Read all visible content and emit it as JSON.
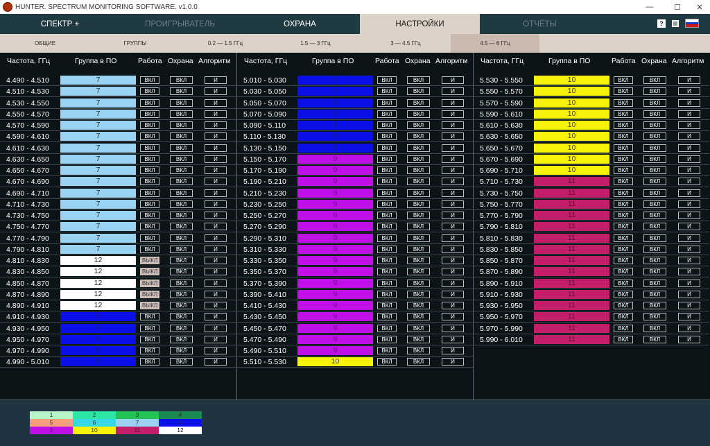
{
  "window": {
    "title": "HUNTER. SPECTRUM MONITORING SOFTWARE. v1.0.0",
    "minimize": "—",
    "maximize": "☐",
    "close": "✕"
  },
  "tabs": [
    {
      "label": "СПЕКТР +",
      "state": "normal"
    },
    {
      "label": "ПРОИГРЫВАТЕЛЬ",
      "state": "disabled"
    },
    {
      "label": "ОХРАНА",
      "state": "normal"
    },
    {
      "label": "НАСТРОЙКИ",
      "state": "active"
    },
    {
      "label": "ОТЧЁТЫ",
      "state": "disabled"
    }
  ],
  "tab_icons": {
    "help": "?",
    "doc": "document-icon"
  },
  "subtabs": [
    {
      "label": "ОБЩИЕ"
    },
    {
      "label": "ГРУППЫ"
    },
    {
      "label": "0.2 — 1.5 ГГц"
    },
    {
      "label": "1.5 — 3 ГГц"
    },
    {
      "label": "3 — 4.5 ГГц"
    },
    {
      "label": "4.5 — 6 ГГц",
      "active": true
    }
  ],
  "headers": {
    "freq": "Частота, ГГц",
    "group": "Группа в ПО",
    "work": "Работа",
    "guard": "Охрана",
    "algo": "Алгоритм"
  },
  "labels": {
    "on": "ВКЛ",
    "off": "ВЫКЛ",
    "algo": "И"
  },
  "group_colors": {
    "1": {
      "bg": "#b6f5c8",
      "fg": "#2a2a2a"
    },
    "2": {
      "bg": "#2ee6a4",
      "fg": "#2a2a2a"
    },
    "3": {
      "bg": "#22c454",
      "fg": "#2a2a2a"
    },
    "4": {
      "bg": "#1b8a52",
      "fg": "#2a2a2a"
    },
    "5": {
      "bg": "#f5a07a",
      "fg": "#3a3a3a"
    },
    "6": {
      "bg": "#36d8e6",
      "fg": "#2a2a2a"
    },
    "7": {
      "bg": "#9ad2f2",
      "fg": "#2a2a2a"
    },
    "8": {
      "bg": "#0c10e8",
      "fg": "#1a1a6a"
    },
    "9": {
      "bg": "#c010e8",
      "fg": "#5a1a70"
    },
    "10": {
      "bg": "#f6f20a",
      "fg": "#3a3a3a"
    },
    "11": {
      "bg": "#c21e6a",
      "fg": "#5a1030"
    },
    "12": {
      "bg": "#ffffff",
      "fg": "#1a1a1a"
    }
  },
  "columns": [
    [
      {
        "freq": "4.490 - 4.510",
        "group": "7",
        "work": "ВКЛ"
      },
      {
        "freq": "4.510 - 4.530",
        "group": "7",
        "work": "ВКЛ"
      },
      {
        "freq": "4.530 - 4.550",
        "group": "7",
        "work": "ВКЛ"
      },
      {
        "freq": "4.550 - 4.570",
        "group": "7",
        "work": "ВКЛ"
      },
      {
        "freq": "4.570 - 4.590",
        "group": "7",
        "work": "ВКЛ"
      },
      {
        "freq": "4.590 - 4.610",
        "group": "7",
        "work": "ВКЛ"
      },
      {
        "freq": "4.610 - 4.630",
        "group": "7",
        "work": "ВКЛ"
      },
      {
        "freq": "4.630 - 4.650",
        "group": "7",
        "work": "ВКЛ"
      },
      {
        "freq": "4.650 - 4.670",
        "group": "7",
        "work": "ВКЛ"
      },
      {
        "freq": "4.670 - 4.690",
        "group": "7",
        "work": "ВКЛ"
      },
      {
        "freq": "4.690 - 4.710",
        "group": "7",
        "work": "ВКЛ"
      },
      {
        "freq": "4.710 - 4.730",
        "group": "7",
        "work": "ВКЛ"
      },
      {
        "freq": "4.730 - 4.750",
        "group": "7",
        "work": "ВКЛ"
      },
      {
        "freq": "4.750 - 4.770",
        "group": "7",
        "work": "ВКЛ"
      },
      {
        "freq": "4.770 - 4.790",
        "group": "7",
        "work": "ВКЛ"
      },
      {
        "freq": "4.790 - 4.810",
        "group": "7",
        "work": "ВКЛ"
      },
      {
        "freq": "4.810 - 4.830",
        "group": "12",
        "work": "ВЫКЛ"
      },
      {
        "freq": "4.830 - 4.850",
        "group": "12",
        "work": "ВЫКЛ"
      },
      {
        "freq": "4.850 - 4.870",
        "group": "12",
        "work": "ВЫКЛ"
      },
      {
        "freq": "4.870 - 4.890",
        "group": "12",
        "work": "ВЫКЛ"
      },
      {
        "freq": "4.890 - 4.910",
        "group": "12",
        "work": "ВЫКЛ"
      },
      {
        "freq": "4.910 - 4.930",
        "group": "8",
        "work": "ВКЛ"
      },
      {
        "freq": "4.930 - 4.950",
        "group": "8",
        "work": "ВКЛ"
      },
      {
        "freq": "4.950 - 4.970",
        "group": "8",
        "work": "ВКЛ"
      },
      {
        "freq": "4.970 - 4.990",
        "group": "8",
        "work": "ВКЛ"
      },
      {
        "freq": "4.990 - 5.010",
        "group": "8",
        "work": "ВКЛ"
      }
    ],
    [
      {
        "freq": "5.010 - 5.030",
        "group": "8",
        "work": "ВКЛ"
      },
      {
        "freq": "5.030 - 5.050",
        "group": "8",
        "work": "ВКЛ"
      },
      {
        "freq": "5.050 - 5.070",
        "group": "8",
        "work": "ВКЛ"
      },
      {
        "freq": "5.070 - 5.090",
        "group": "8",
        "work": "ВКЛ"
      },
      {
        "freq": "5.090 - 5.110",
        "group": "8",
        "work": "ВКЛ"
      },
      {
        "freq": "5.110 - 5.130",
        "group": "8",
        "work": "ВКЛ"
      },
      {
        "freq": "5.130 - 5.150",
        "group": "8",
        "work": "ВКЛ"
      },
      {
        "freq": "5.150 - 5.170",
        "group": "9",
        "work": "ВКЛ"
      },
      {
        "freq": "5.170 - 5.190",
        "group": "9",
        "work": "ВКЛ"
      },
      {
        "freq": "5.190 - 5.210",
        "group": "9",
        "work": "ВКЛ"
      },
      {
        "freq": "5.210 - 5.230",
        "group": "9",
        "work": "ВКЛ"
      },
      {
        "freq": "5.230 - 5.250",
        "group": "9",
        "work": "ВКЛ"
      },
      {
        "freq": "5.250 - 5.270",
        "group": "9",
        "work": "ВКЛ"
      },
      {
        "freq": "5.270 - 5.290",
        "group": "9",
        "work": "ВКЛ"
      },
      {
        "freq": "5.290 - 5.310",
        "group": "9",
        "work": "ВКЛ"
      },
      {
        "freq": "5.310 - 5.330",
        "group": "9",
        "work": "ВКЛ"
      },
      {
        "freq": "5.330 - 5.350",
        "group": "9",
        "work": "ВКЛ"
      },
      {
        "freq": "5.350 - 5.370",
        "group": "9",
        "work": "ВКЛ"
      },
      {
        "freq": "5.370 - 5.390",
        "group": "9",
        "work": "ВКЛ"
      },
      {
        "freq": "5.390 - 5.410",
        "group": "9",
        "work": "ВКЛ"
      },
      {
        "freq": "5.410 - 5.430",
        "group": "9",
        "work": "ВКЛ"
      },
      {
        "freq": "5.430 - 5.450",
        "group": "9",
        "work": "ВКЛ"
      },
      {
        "freq": "5.450 - 5.470",
        "group": "9",
        "work": "ВКЛ"
      },
      {
        "freq": "5.470 - 5.490",
        "group": "9",
        "work": "ВКЛ"
      },
      {
        "freq": "5.490 - 5.510",
        "group": "9",
        "work": "ВКЛ"
      },
      {
        "freq": "5.510 - 5.530",
        "group": "10",
        "work": "ВКЛ"
      }
    ],
    [
      {
        "freq": "5.530 - 5.550",
        "group": "10",
        "work": "ВКЛ"
      },
      {
        "freq": "5.550 - 5.570",
        "group": "10",
        "work": "ВКЛ"
      },
      {
        "freq": "5.570 - 5.590",
        "group": "10",
        "work": "ВКЛ"
      },
      {
        "freq": "5.590 - 5.610",
        "group": "10",
        "work": "ВКЛ"
      },
      {
        "freq": "5.610 - 5.630",
        "group": "10",
        "work": "ВКЛ"
      },
      {
        "freq": "5.630 - 5.650",
        "group": "10",
        "work": "ВКЛ"
      },
      {
        "freq": "5.650 - 5.670",
        "group": "10",
        "work": "ВКЛ"
      },
      {
        "freq": "5.670 - 5.690",
        "group": "10",
        "work": "ВКЛ"
      },
      {
        "freq": "5.690 - 5.710",
        "group": "10",
        "work": "ВКЛ"
      },
      {
        "freq": "5.710 - 5.730",
        "group": "11",
        "work": "ВКЛ"
      },
      {
        "freq": "5.730 - 5.750",
        "group": "11",
        "work": "ВКЛ"
      },
      {
        "freq": "5.750 - 5.770",
        "group": "11",
        "work": "ВКЛ"
      },
      {
        "freq": "5.770 - 5.790",
        "group": "11",
        "work": "ВКЛ"
      },
      {
        "freq": "5.790 - 5.810",
        "group": "11",
        "work": "ВКЛ"
      },
      {
        "freq": "5.810 - 5.830",
        "group": "11",
        "work": "ВКЛ"
      },
      {
        "freq": "5.830 - 5.850",
        "group": "11",
        "work": "ВКЛ"
      },
      {
        "freq": "5.850 - 5.870",
        "group": "11",
        "work": "ВКЛ"
      },
      {
        "freq": "5.870 - 5.890",
        "group": "11",
        "work": "ВКЛ"
      },
      {
        "freq": "5.890 - 5.910",
        "group": "11",
        "work": "ВКЛ"
      },
      {
        "freq": "5.910 - 5.930",
        "group": "11",
        "work": "ВКЛ"
      },
      {
        "freq": "5.930 - 5.950",
        "group": "11",
        "work": "ВКЛ"
      },
      {
        "freq": "5.950 - 5.970",
        "group": "11",
        "work": "ВКЛ"
      },
      {
        "freq": "5.970 - 5.990",
        "group": "11",
        "work": "ВКЛ"
      },
      {
        "freq": "5.990 - 6.010",
        "group": "11",
        "work": "ВКЛ"
      }
    ]
  ],
  "legend": [
    "1",
    "2",
    "3",
    "4",
    "5",
    "6",
    "7",
    "8",
    "9",
    "10",
    "11",
    "12"
  ]
}
